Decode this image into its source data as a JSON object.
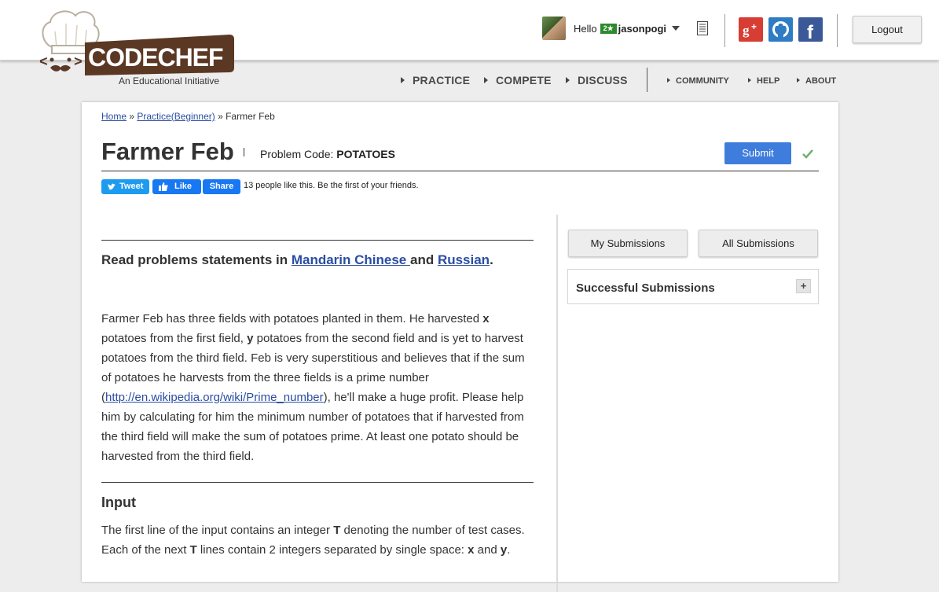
{
  "header": {
    "logo_text": "CODECHEF",
    "logo_tagline": "An Educational Initiative",
    "greeting": "Hello",
    "user_rating_badge": "2★",
    "username": "jasonpogi",
    "logout_label": "Logout"
  },
  "nav": {
    "main": [
      "PRACTICE",
      "COMPETE",
      "DISCUSS"
    ],
    "sub": [
      "COMMUNITY",
      "HELP",
      "ABOUT"
    ]
  },
  "breadcrumb": {
    "home": "Home",
    "sep1": " » ",
    "practice": "Practice(Beginner)",
    "sep2": " » ",
    "current": "Farmer Feb"
  },
  "problem": {
    "title": "Farmer Feb",
    "code_label": "Problem Code: ",
    "code": "POTATOES",
    "submit_label": "Submit"
  },
  "social": {
    "tweet": "Tweet",
    "like": "Like",
    "share": "Share",
    "likes_text": "13 people like this. Be the first of your friends."
  },
  "statement": {
    "read_prefix": "Read problems statements in ",
    "mandarin": "Mandarin Chinese ",
    "and": "and ",
    "russian": "Russian",
    "period": ".",
    "p1_a": "Farmer Feb has three fields with potatoes planted in them. He harvested ",
    "p1_x": "x",
    "p1_b": " potatoes from the first field, ",
    "p1_y": "y",
    "p1_c": " potatoes from the second field and is yet to harvest potatoes from the third field. Feb is very superstitious and believes that if the sum of potatoes he harvests from the three fields is a prime number (",
    "p1_link": "http://en.wikipedia.org/wiki/Prime_number",
    "p1_d": "), he'll make a huge profit. Please help him by calculating for him the minimum number of potatoes that if harvested from the third field will make the sum of potatoes prime. At least one potato should be harvested from the third field.",
    "input_heading": "Input",
    "in_a": "The first line of the input contains an integer ",
    "in_T": "T",
    "in_b": " denoting the number of test cases. Each of the next ",
    "in_T2": "T",
    "in_c": " lines contain 2 integers separated by single space: ",
    "in_x": "x",
    "in_and": " and ",
    "in_y": "y",
    "in_end": "."
  },
  "sidebar": {
    "my_submissions": "My Submissions",
    "all_submissions": "All Submissions",
    "successful_submissions": "Successful Submissions",
    "expand": "+"
  },
  "colors": {
    "link": "#2b4ea2",
    "submit": "#3e7ddb",
    "google": "#d73d32",
    "github": "#2f7cc4",
    "facebook": "#3b5998"
  },
  "icons": [
    "chef-hat-logo",
    "notes-icon",
    "google-plus-icon",
    "github-icon",
    "facebook-icon",
    "check-icon",
    "twitter-bird-icon",
    "thumbs-up-icon",
    "plus-icon"
  ]
}
